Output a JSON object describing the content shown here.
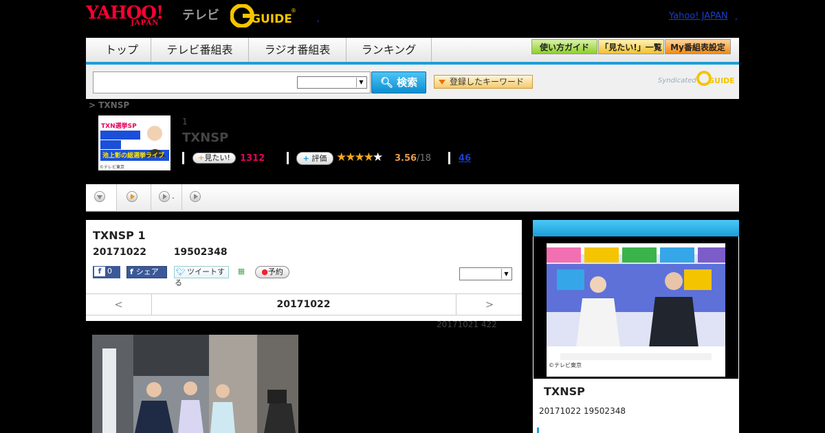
{
  "header": {
    "yahoo_logo": "YAHOO!",
    "yahoo_logo_sub": "JAPAN",
    "tv_label": "テレビ",
    "gguide_logo": "G GUIDE",
    "yahoo_japan_link": "Yahoo! JAPAN",
    "sep_dot": ","
  },
  "nav": {
    "tabs": [
      {
        "label": "トップ"
      },
      {
        "label": "テレビ番組表"
      },
      {
        "label": "ラジオ番組表"
      },
      {
        "label": "ランキング"
      }
    ],
    "guide_button": "使い方ガイド",
    "want_list_button": "「見たい!」一覧",
    "my_schedule_button": "My番組表設定"
  },
  "search": {
    "query": "",
    "select_value": "",
    "search_button": "検索",
    "keyword_button": "登録したキーワード",
    "syndicated_label": "Syndicated",
    "syndicated_logo": "G GUIDE"
  },
  "program": {
    "breadcrumb": "> TXNSP",
    "number": "1",
    "title": "TXNSP",
    "want_button": "見たい!",
    "want_count": "1312",
    "rate_button": "評価",
    "rating_value": 3.56,
    "stars": "★★★★★",
    "score": "3.56",
    "score_den": "/18",
    "comments_count": "46"
  },
  "subnav": {
    "items": [
      {
        "label": ""
      },
      {
        "label": "."
      },
      {
        "label": ""
      },
      {
        "label": ""
      }
    ]
  },
  "card": {
    "title": "TXNSP  1",
    "date_code": "20171022",
    "id_code": "19502348",
    "facebook_count": "0",
    "share_button": "シェア",
    "tweet_button": "ツイートする",
    "reserve_button": "予約",
    "select_value": "",
    "prev_label": "<",
    "date_label": "20171022",
    "next_label": ">"
  },
  "update_note": "20171021  422",
  "side": {
    "thumb_credit": "©テレビ東京",
    "title": "TXNSP",
    "meta": "20171022  19502348"
  },
  "thumb": {
    "caption_top": "TXN選挙SP",
    "caption_main": "池上彰の総選挙ライブ",
    "credit": "©テレビ東京"
  },
  "colors": {
    "accent": "#1a9fd9",
    "want_count": "#e8005a",
    "score": "#e89a4a",
    "link": "#1a3ec9"
  }
}
